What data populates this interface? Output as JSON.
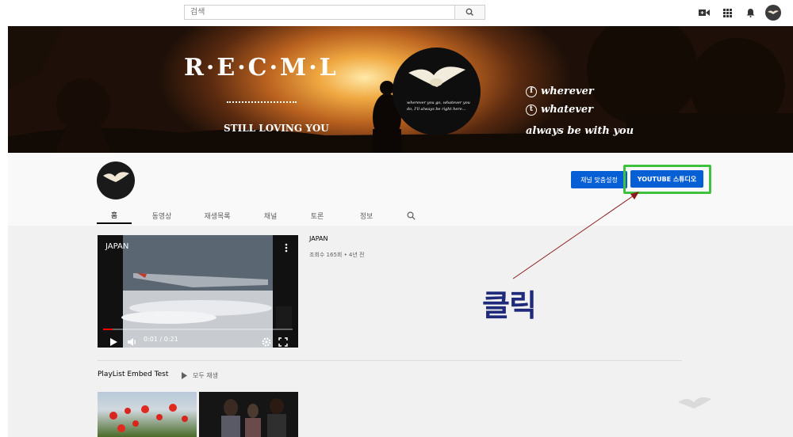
{
  "search": {
    "placeholder": "검색"
  },
  "banner": {
    "title": "R·E·C·M·L",
    "subtitle": "STILL LOVING YOU",
    "line1": "wherever",
    "line2": "whatever",
    "line3": "always be with you",
    "logo_text": "wherever you go, whatever you do, I'll always be right here..."
  },
  "channel": {
    "customize_label": "채널 맞춤설정",
    "studio_label": "YOUTUBE 스튜디오",
    "tabs": [
      "홈",
      "동영상",
      "재생목록",
      "채널",
      "토론",
      "정보"
    ]
  },
  "featured_video": {
    "overlay_title": "JAPAN",
    "time": "0:01 / 0:21",
    "progress": 0.05,
    "title": "JAPAN",
    "meta": "조회수 165회 • 4년 전"
  },
  "playlist": {
    "title": "PlayList Embed Test",
    "play_all": "모두 재생"
  },
  "annotation": {
    "text": "클릭"
  },
  "colors": {
    "accent_blue": "#065fd4",
    "highlight_green": "#3ec23e",
    "annotation_navy": "#1f2a7a",
    "arrow_red": "#8b1a1a"
  }
}
